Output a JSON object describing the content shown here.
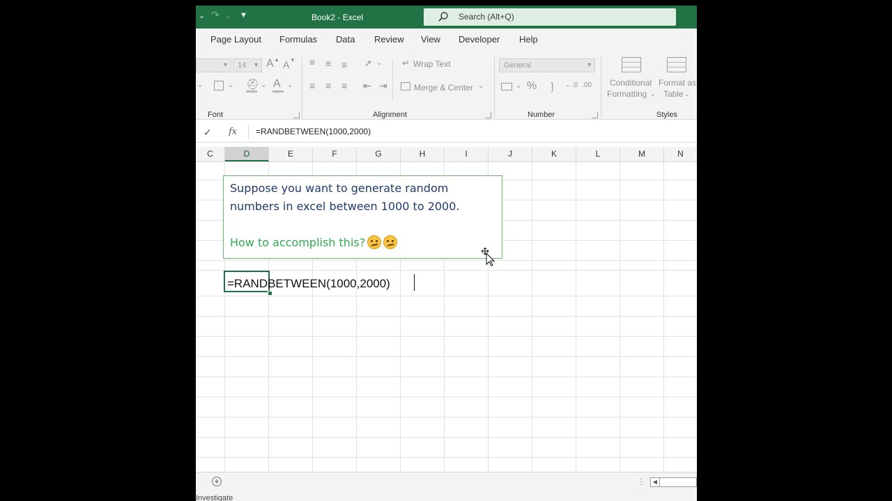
{
  "titlebar": {
    "doc_title": "Book2  -  Excel",
    "search_placeholder": "Search (Alt+Q)"
  },
  "tabs": [
    "Page Layout",
    "Formulas",
    "Data",
    "Review",
    "View",
    "Developer",
    "Help"
  ],
  "ribbon": {
    "font": {
      "size_value": "14",
      "grow_label": "A",
      "shrink_label": "A",
      "group_label": "Font"
    },
    "alignment": {
      "wrap_text": "Wrap Text",
      "merge_center": "Merge & Center",
      "group_label": "Alignment"
    },
    "number": {
      "format_value": "General",
      "percent": "%",
      "group_label": "Number"
    },
    "styles": {
      "conditional_line1": "Conditional",
      "conditional_line2": "Formatting",
      "format_as_line1": "Format as",
      "format_as_line2": "Table",
      "group_label": "Styles"
    }
  },
  "formula_bar": {
    "fx": "fx",
    "content": "=RANDBETWEEN(1000,2000)"
  },
  "columns": [
    "C",
    "D",
    "E",
    "F",
    "G",
    "H",
    "I",
    "J",
    "K",
    "L",
    "M",
    "N"
  ],
  "active_column": "D",
  "note": {
    "line1": "Suppose you want to generate random",
    "line2": "numbers in excel between 1000 to 2000.",
    "question": "How to accomplish this?"
  },
  "active_cell_content": "=RANDBETWEEN(1000,2000)",
  "status": {
    "text": "Investigate"
  },
  "colors": {
    "excel_green": "#217346",
    "note_text": "#1f3c6b",
    "note_question": "#2eaa4f"
  }
}
